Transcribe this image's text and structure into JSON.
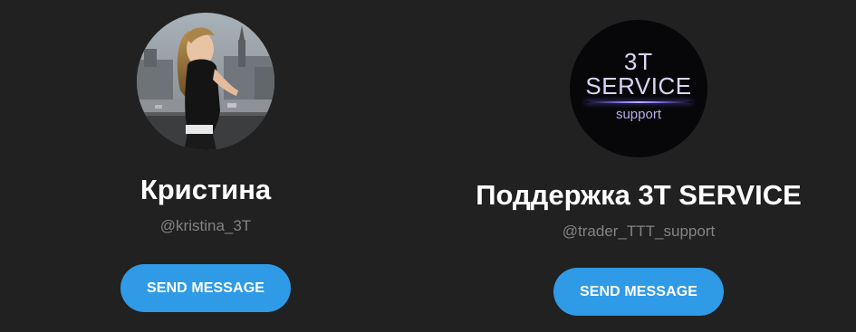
{
  "contacts": [
    {
      "name": "Кристина",
      "username": "@kristina_3T",
      "button_label": "SEND MESSAGE",
      "avatar_icon": "person-photo"
    },
    {
      "name": "Поддержка 3T SERVICE",
      "username": "@trader_TTT_support",
      "button_label": "SEND MESSAGE",
      "avatar_icon": "service-logo",
      "logo": {
        "line1": "3T",
        "line2": "SERVICE",
        "line3": "support"
      }
    }
  ],
  "colors": {
    "background": "#212121",
    "button": "#2f9ae6",
    "name_text": "#ffffff",
    "username_text": "#838383"
  }
}
